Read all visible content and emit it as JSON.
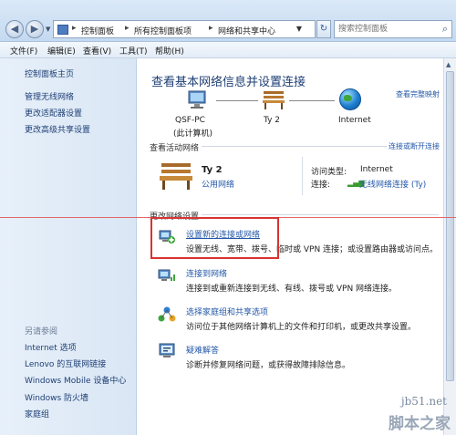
{
  "address_bar": {
    "breadcrumb": [
      "控制面板",
      "所有控制面板项",
      "网络和共享中心"
    ],
    "search_placeholder": "搜索控制面板"
  },
  "menu": [
    "文件(F)",
    "编辑(E)",
    "查看(V)",
    "工具(T)",
    "帮助(H)"
  ],
  "sidebar": {
    "top_links": [
      "控制面板主页",
      "管理无线网络",
      "更改适配器设置",
      "更改高级共享设置"
    ],
    "see_also_heading": "另请参阅",
    "see_also_links": [
      "Internet 选项",
      "Lenovo 的互联网链接",
      "Windows Mobile 设备中心",
      "Windows 防火墙",
      "家庭组"
    ]
  },
  "main": {
    "title": "查看基本网络信息并设置连接",
    "view_full_map": "查看完整映射",
    "map_nodes": [
      {
        "name": "QSF-PC",
        "sub": "(此计算机)"
      },
      {
        "name": "Ty 2",
        "sub": ""
      },
      {
        "name": "Internet",
        "sub": ""
      }
    ],
    "active_networks_label": "查看活动网络",
    "connect_disconnect": "连接或断开连接",
    "network": {
      "name": "Ty 2",
      "type_link": "公用网络",
      "access_type_label": "访问类型:",
      "access_type_value": "Internet",
      "connection_label": "连接:",
      "connection_value": "无线网络连接 (Ty)"
    },
    "change_settings_label": "更改网络设置",
    "tasks": [
      {
        "title": "设置新的连接或网络",
        "desc": "设置无线、宽带、拨号、临时或 VPN 连接；或设置路由器或访问点。"
      },
      {
        "title": "连接到网络",
        "desc": "连接到或重新连接到无线、有线、拨号或 VPN 网络连接。"
      },
      {
        "title": "选择家庭组和共享选项",
        "desc": "访问位于其他网络计算机上的文件和打印机，或更改共享设置。"
      },
      {
        "title": "疑难解答",
        "desc": "诊断并修复网络问题，或获得故障排除信息。"
      }
    ]
  },
  "watermark": {
    "site": "jb51.net",
    "brand": "脚本之家"
  },
  "colors": {
    "link": "#2458a8",
    "title": "#1e3f75",
    "highlight": "#d83232",
    "sidebar_bg": "#dde9f5"
  }
}
